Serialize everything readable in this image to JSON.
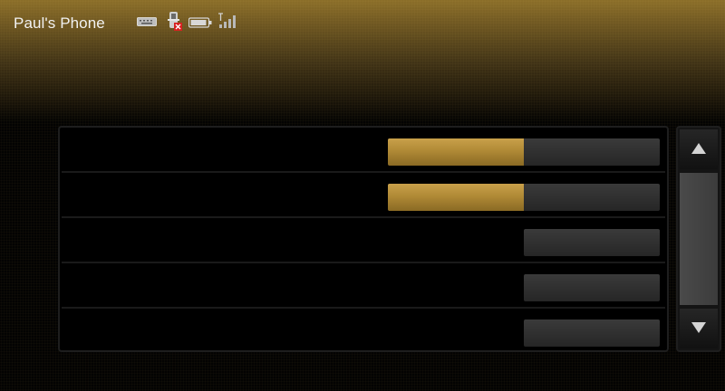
{
  "status_bar": {
    "device_name": "Paul's Phone",
    "icons": [
      "keyboard-icon",
      "phone-icon",
      "battery-icon",
      "signal-icon"
    ]
  },
  "list": {
    "rows": [
      {
        "label": "",
        "control": "level",
        "level_fraction": 0.5
      },
      {
        "label": "",
        "control": "level",
        "level_fraction": 0.5
      },
      {
        "label": "",
        "control": "button"
      },
      {
        "label": "",
        "control": "button"
      },
      {
        "label": "",
        "control": "button"
      }
    ]
  },
  "scrollbar": {
    "up_icon": "triangle-up-icon",
    "down_icon": "triangle-down-icon"
  },
  "colors": {
    "accent_gold": "#b08a36",
    "header_gold": "#8a6d28",
    "background": "#000000",
    "control_gray": "#2f2f2f"
  }
}
